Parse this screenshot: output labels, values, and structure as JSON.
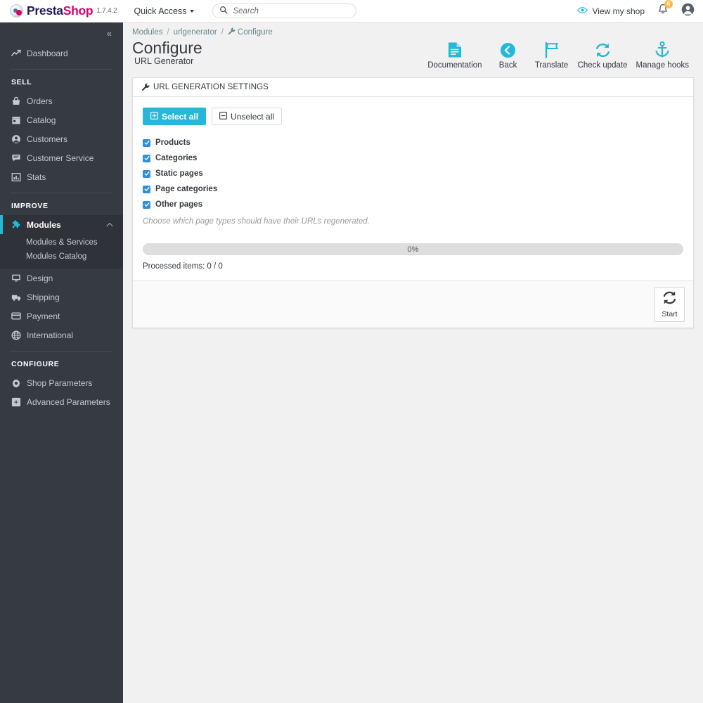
{
  "header": {
    "brand_first": "Presta",
    "brand_second": "Shop",
    "version": "1.7.4.2",
    "quick_access": "Quick Access",
    "search_placeholder": "Search",
    "search_value": "",
    "view_shop": "View my shop",
    "notification_count": "6",
    "accent_color": "#25b9d7",
    "brand_pink": "#df0067"
  },
  "sidebar": {
    "collapse_glyph": "«",
    "dashboard": {
      "label": "Dashboard",
      "icon": "trend-line-icon"
    },
    "sections": [
      {
        "title": "SELL",
        "items": [
          {
            "label": "Orders",
            "icon": "basket-icon"
          },
          {
            "label": "Catalog",
            "icon": "store-icon"
          },
          {
            "label": "Customers",
            "icon": "person-icon"
          },
          {
            "label": "Customer Service",
            "icon": "chat-icon"
          },
          {
            "label": "Stats",
            "icon": "bar-chart-icon"
          }
        ]
      },
      {
        "title": "IMPROVE",
        "items": [
          {
            "label": "Modules",
            "icon": "puzzle-icon",
            "active": true,
            "submenu": [
              "Modules & Services",
              "Modules Catalog"
            ]
          },
          {
            "label": "Design",
            "icon": "monitor-icon"
          },
          {
            "label": "Shipping",
            "icon": "truck-icon"
          },
          {
            "label": "Payment",
            "icon": "credit-card-icon"
          },
          {
            "label": "International",
            "icon": "globe-icon"
          }
        ]
      },
      {
        "title": "CONFIGURE",
        "items": [
          {
            "label": "Shop Parameters",
            "icon": "gear-icon"
          },
          {
            "label": "Advanced Parameters",
            "icon": "sliders-icon"
          }
        ]
      }
    ]
  },
  "breadcrumb": {
    "item1": "Modules",
    "item2": "urlgenerator",
    "current": "Configure",
    "separator": "/"
  },
  "page": {
    "title": "Configure",
    "subtitle": "URL Generator"
  },
  "toolbar": [
    {
      "label": "Documentation",
      "icon": "document-icon"
    },
    {
      "label": "Back",
      "icon": "back-arrow-icon"
    },
    {
      "label": "Translate",
      "icon": "flag-icon"
    },
    {
      "label": "Check update",
      "icon": "refresh-icon"
    },
    {
      "label": "Manage hooks",
      "icon": "anchor-icon"
    }
  ],
  "panel": {
    "title": "URL GENERATION SETTINGS",
    "title_icon": "wrench-icon",
    "select_all": "Select all",
    "unselect_all": "Unselect all",
    "checkboxes": [
      {
        "label": "Products",
        "checked": true
      },
      {
        "label": "Categories",
        "checked": true
      },
      {
        "label": "Static pages",
        "checked": true
      },
      {
        "label": "Page categories",
        "checked": true
      },
      {
        "label": "Other pages",
        "checked": true
      }
    ],
    "hint": "Choose which page types should have their URLs regenerated.",
    "progress_percent": 0,
    "progress_label": "0%",
    "processed_items": "Processed items: 0 / 0",
    "start_label": "Start",
    "start_icon": "refresh-icon"
  }
}
